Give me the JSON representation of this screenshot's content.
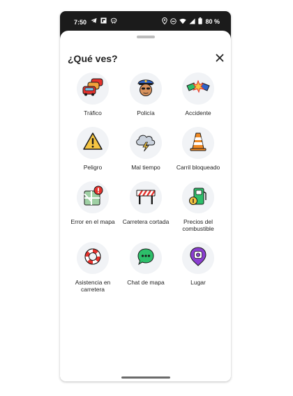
{
  "status_bar": {
    "time": "7:50",
    "battery": "80 %"
  },
  "sheet": {
    "title": "¿Qué ves?"
  },
  "items": [
    {
      "label": "Tráfico",
      "icon": "traffic-cars-icon"
    },
    {
      "label": "Policía",
      "icon": "police-officer-icon"
    },
    {
      "label": "Accidente",
      "icon": "car-crash-icon"
    },
    {
      "label": "Peligro",
      "icon": "warning-triangle-icon"
    },
    {
      "label": "Mal tiempo",
      "icon": "storm-cloud-icon"
    },
    {
      "label": "Carril bloqueado",
      "icon": "traffic-cone-icon"
    },
    {
      "label": "Error en el mapa",
      "icon": "map-error-icon"
    },
    {
      "label": "Carretera cortada",
      "icon": "road-barrier-icon"
    },
    {
      "label": "Precios del combustible",
      "icon": "fuel-pump-icon"
    },
    {
      "label": "Asistencia en carretera",
      "icon": "lifebuoy-icon"
    },
    {
      "label": "Chat de mapa",
      "icon": "chat-bubble-icon"
    },
    {
      "label": "Lugar",
      "icon": "place-pin-icon"
    }
  ],
  "colors": {
    "tile_background": "#f1f3f6",
    "title_text": "#1f1f1f"
  }
}
